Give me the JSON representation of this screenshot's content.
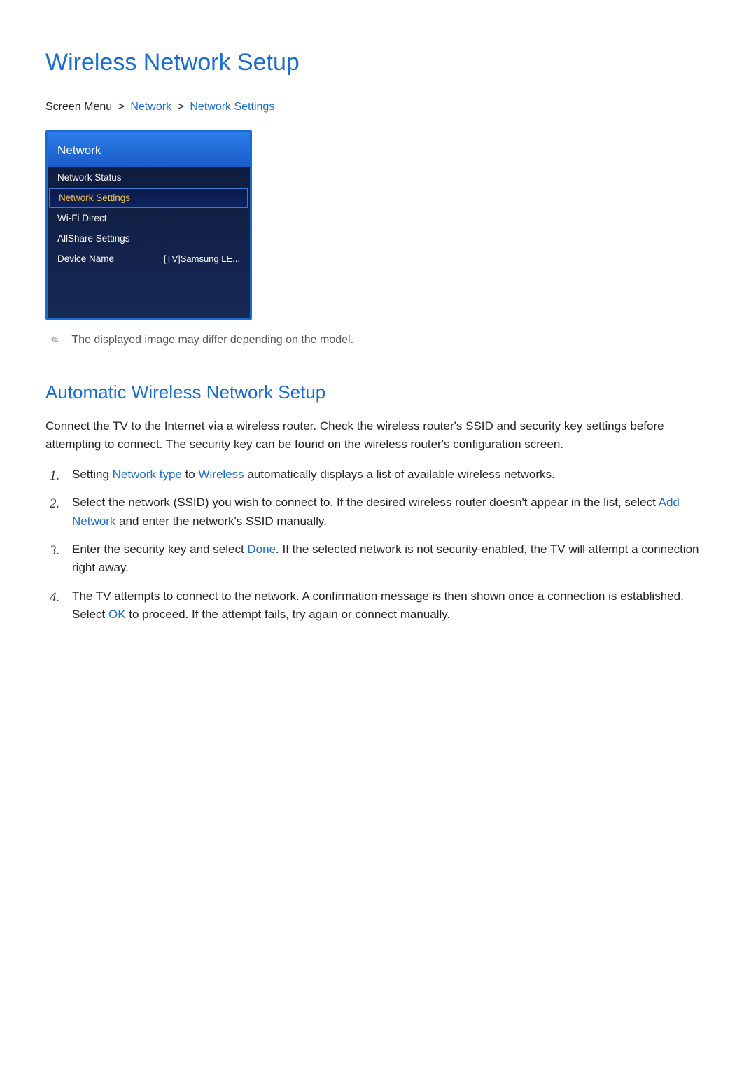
{
  "page_title": "Wireless Network Setup",
  "breadcrumb": {
    "prefix": "Screen Menu",
    "sep": ">",
    "link1": "Network",
    "link2": "Network Settings"
  },
  "tv_menu": {
    "header": "Network",
    "items": [
      {
        "label": "Network Status",
        "value": "",
        "selected": false
      },
      {
        "label": "Network Settings",
        "value": "",
        "selected": true
      },
      {
        "label": "Wi-Fi Direct",
        "value": "",
        "selected": false
      },
      {
        "label": "AllShare Settings",
        "value": "",
        "selected": false
      },
      {
        "label": "Device Name",
        "value": "[TV]Samsung LE...",
        "selected": false
      }
    ]
  },
  "note": "The displayed image may differ depending on the model.",
  "section_title": "Automatic Wireless Network Setup",
  "intro_paragraph": "Connect the TV to the Internet via a wireless router. Check the wireless router's SSID and security key settings before attempting to connect. The security key can be found on the wireless router's configuration screen.",
  "steps": [
    {
      "pre1": "Setting ",
      "hl1": "Network type",
      "mid1": " to ",
      "hl2": "Wireless",
      "post1": " automatically displays a list of available wireless networks."
    },
    {
      "pre1": "Select the network (SSID) you wish to connect to. If the desired wireless router doesn't appear in the list, select ",
      "hl1": "Add Network",
      "post1": " and enter the network's SSID manually."
    },
    {
      "pre1": "Enter the security key and select ",
      "hl1": "Done",
      "post1": ". If the selected network is not security-enabled, the TV will attempt a connection right away."
    },
    {
      "pre1": "The TV attempts to connect to the network. A confirmation message is then shown once a connection is established. Select ",
      "hl1": "OK",
      "post1": " to proceed. If the attempt fails, try again or connect manually."
    }
  ]
}
